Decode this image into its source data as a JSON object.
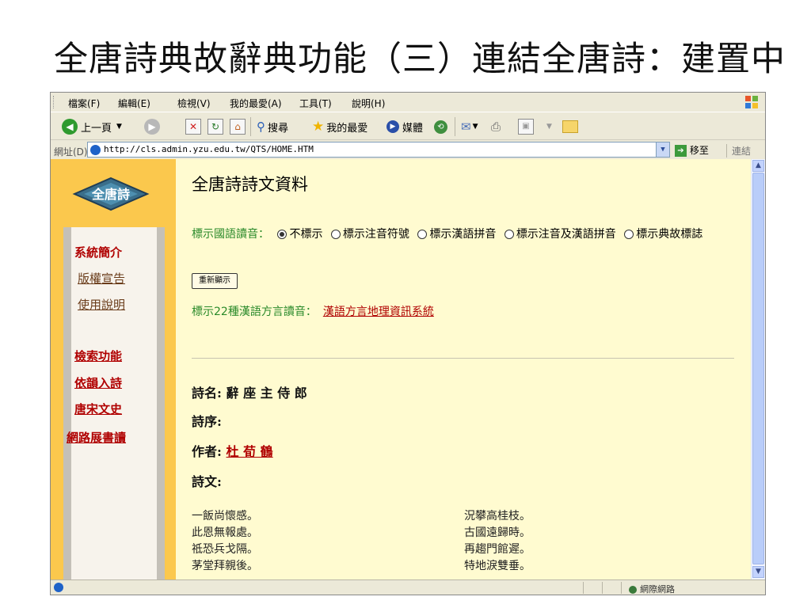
{
  "slide": {
    "title": "全唐詩典故辭典功能（三）連結全唐詩：建置中"
  },
  "browser": {
    "menu": [
      "檔案(F)",
      "編輯(E)",
      "檢視(V)",
      "我的最愛(A)",
      "工具(T)",
      "說明(H)"
    ],
    "toolbar": {
      "back": "上一頁",
      "search": "搜尋",
      "favorites": "我的最愛",
      "media": "媒體"
    },
    "address": {
      "label": "網址(D)",
      "url": "http://cls.admin.yzu.edu.tw/QTS/HOME.HTM",
      "go": "移至",
      "links": "連結"
    },
    "status": {
      "zone": "網際網路"
    }
  },
  "sidebar": {
    "logo_text": "全唐詩",
    "items": [
      "系統簡介",
      "版權宣告",
      "使用說明",
      "檢索功能",
      "依韻入詩",
      "唐宋文史",
      "網路展書讀"
    ]
  },
  "page": {
    "heading": "全唐詩詩文資料",
    "pronunciation_label": "標示國語讀音：",
    "options": [
      "不標示",
      "標示注音符號",
      "標示漢語拼音",
      "標示注音及漢語拼音",
      "標示典故標誌"
    ],
    "selected_option": "不標示",
    "redisplay_button": "重新顯示",
    "dialect_label": "標示22種漢語方言讀音：",
    "dialect_link": "漢語方言地理資訊系統",
    "poem": {
      "title_label": "詩名:",
      "title": "辭 座 主 侍 郎",
      "preface_label": "詩序:",
      "author_label": "作者:",
      "author": "杜 荀 鶴",
      "text_label": "詩文:",
      "lines_left": [
        "一飯尚懷感。",
        "此恩無報處。",
        "祗恐兵戈隔。",
        "茅堂拜親後。"
      ],
      "lines_right": [
        "況攀高桂枝。",
        "古國遠歸時。",
        "再趨門館遲。",
        "特地淚雙垂。"
      ]
    }
  }
}
